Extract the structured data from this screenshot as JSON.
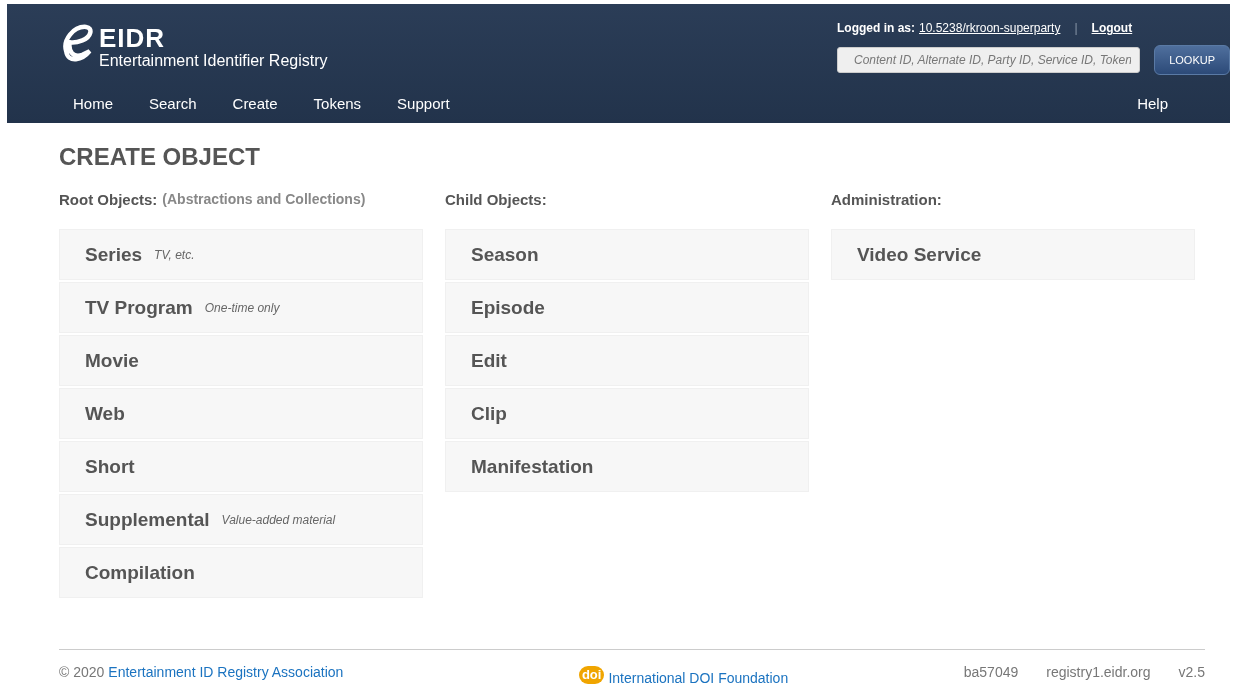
{
  "header": {
    "logo": {
      "wordmark": "EIDR",
      "subtitle": "Entertainment Identifier Registry"
    },
    "login": {
      "label": "Logged in as:",
      "user": "10.5238/rkroon-superparty",
      "separator": "|",
      "logout": "Logout"
    },
    "lookup": {
      "placeholder": "Content ID, Alternate ID, Party ID, Service ID, Token",
      "button": "LOOKUP"
    },
    "nav": [
      {
        "label": "Home"
      },
      {
        "label": "Search"
      },
      {
        "label": "Create"
      },
      {
        "label": "Tokens"
      },
      {
        "label": "Support"
      }
    ],
    "help": "Help"
  },
  "page_title": "CREATE OBJECT",
  "columns": [
    {
      "heading": "Root Objects:",
      "subheading": "(Abstractions and Collections)",
      "items": [
        {
          "label": "Series",
          "note": "TV, etc."
        },
        {
          "label": "TV Program",
          "note": "One-time only"
        },
        {
          "label": "Movie"
        },
        {
          "label": "Web"
        },
        {
          "label": "Short"
        },
        {
          "label": "Supplemental",
          "note": "Value-added material"
        },
        {
          "label": "Compilation"
        }
      ]
    },
    {
      "heading": "Child Objects:",
      "items": [
        {
          "label": "Season"
        },
        {
          "label": "Episode"
        },
        {
          "label": "Edit"
        },
        {
          "label": "Clip"
        },
        {
          "label": "Manifestation"
        }
      ]
    },
    {
      "heading": "Administration:",
      "items": [
        {
          "label": "Video Service"
        }
      ]
    }
  ],
  "footer": {
    "copyright": "© 2020",
    "association": "Entertainment ID Registry Association",
    "doi_logo": "doi",
    "doi_link": "International DOI Foundation",
    "build": "ba57049",
    "server": "registry1.eidr.org",
    "version": "v2.5"
  }
}
